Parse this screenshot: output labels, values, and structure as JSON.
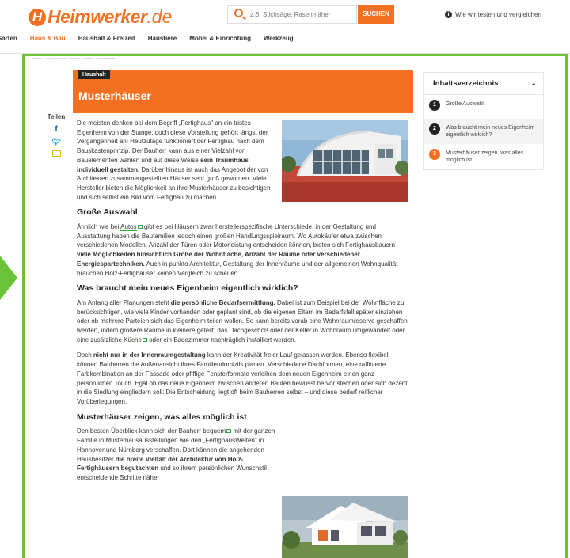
{
  "header": {
    "logo_badge": "H",
    "logo_main": "Heimwerker",
    "logo_tld": ".de",
    "search_placeholder": "z.B. Stichsäge, Rasenmäher",
    "search_button": "SUCHEN",
    "info_link": "Wie wir testen und vergleichen",
    "accent_color": "#f36f21"
  },
  "nav": {
    "items": [
      "Garten",
      "Haus & Bau",
      "Haushalt & Freizeit",
      "Haustiere",
      "Möbel & Einrichtung",
      "Werkzeug"
    ],
    "active": "Haus & Bau"
  },
  "frame_color": "#6ac238",
  "article": {
    "tag": "Haushalt",
    "title": "Musterhäuser",
    "share_label": "Teilen",
    "p1_a": "Die meisten denken bei dem Begriff „Fertighaus\" an ein tristes Eigenheim von der Stange, doch diese Vorstellung gehört längst der Vergangenheit an! Heutzutage funktioniert der Fertigbau nach dem Bauskastenprinzip. Der Bauherr kann aus einer Vielzahl von Bauelementen wählen und auf diese Weise ",
    "p1_b": "sein Traumhaus individuell gestalten.",
    "p1_c": " Darüber hinaus ist auch das Angebot der von Architekten zusammengestellten Häuser sehr groß geworden. Viele Hersteller bieten die Möglichkeit an ihre Musterhäuser zu besichtigen und sich selbst ein Bild vom Fertigbau zu machen.",
    "h2_1": "Große Auswahl",
    "p2_a": "Ähnlich wie bei ",
    "p2_link": "Autos",
    "p2_b": " gibt es bei Häusern zwar herstellerspezifische Unterschiede, in der Gestaltung und Ausstattung haben die Baufamilien jedoch einen großen Handlungsspielraum. Wo Autokäufer etwa zwischen verschiedenen Modellen, Anzahl der Türen oder Motorleistung entscheiden können, bieten sich Fertighausbauern ",
    "p2_c": "viele Möglichkeiten hinsichtlich Größe der Wohnfläche, Anzahl der Räume oder verschiedener Energiespartechniken.",
    "p2_d": " Auch in punkto Architektur, Gestaltung der Innenräume und der allgemeinen Wohnqualität brauchen Holz-Fertighäuser keinen Vergleich zu scheuen.",
    "h2_2": "Was braucht mein neues Eigenheim eigentlich wirklich?",
    "p3_a": "Am Anfang aller Planungen steht ",
    "p3_b": "die persönliche Bedarfsermittlung.",
    "p3_c": " Dabei ist zum Beispiel bei der Wohnfläche zu berücksichtigen, wie viele Kinder vorhanden oder geplant sind, ob die eigenen Eltern im Bedarfsfall später einziehen oder ob mehrere Parteien sich das Eigenheim teilen wollen. So kann bereits vorab eine Wohnraumreserve geschaffen werden, indem größere Räume in kleinere geteilt, das Dachgeschoß oder der Keller in Wohnraum umgewandelt oder eine zusätzliche ",
    "p3_link": "Küche",
    "p3_d": " oder ein Badezimmer nachträglich installiert werden.",
    "p4_a": "Doch ",
    "p4_b": "nicht nur in der Innenraumgestaltung",
    "p4_c": " kann der Kreativität freier Lauf gelassen werden. Ebenso flexibel können Bauherren die Außenansicht ihres Familiendomizils planen. Verschiedene Dachformen, eine raffinierte Farbkombination an der Fassade oder pfiffige Fensterformate verleihen dem neuen Eigenheim einen ganz persönlichen Touch. Egal ob das neue Eigenheim zwischen anderen Bauten bewusst hervor stechen oder sich dezent in die Siedlung eingliedern soll: Die Entscheidung liegt oft beim Bauherren selbst – und diese bedarf reiflicher Vorüberlegungen.",
    "h2_3": "Musterhäuser zeigen, was alles möglich ist",
    "p5_a": "Den besten Überblick kann sich der Bauherr ",
    "p5_link": "bequem",
    "p5_b": " mit der ganzen Familie in Musterhausausstellungen wie den „FertighausWelten\" in Hannover und Nürnberg verschaffen. Dort können die angehenden Hausbesitzer ",
    "p5_c": "die breite Vielfalt der Architektur von Holz-Fertighäusern begutachten",
    "p5_d": " und so ihrem persönlichen Wunschstil entscheidende Schritte näher"
  },
  "toc": {
    "title": "Inhaltsverzeichnis",
    "toggle": "-",
    "items": [
      {
        "num": "1",
        "label": "Große Auswahl"
      },
      {
        "num": "2",
        "label": "Was braucht mein neues Eigenheim eigentlich wirklich?"
      },
      {
        "num": "3",
        "label": "Musterhäuser zeigen, was alles möglich ist"
      }
    ]
  }
}
